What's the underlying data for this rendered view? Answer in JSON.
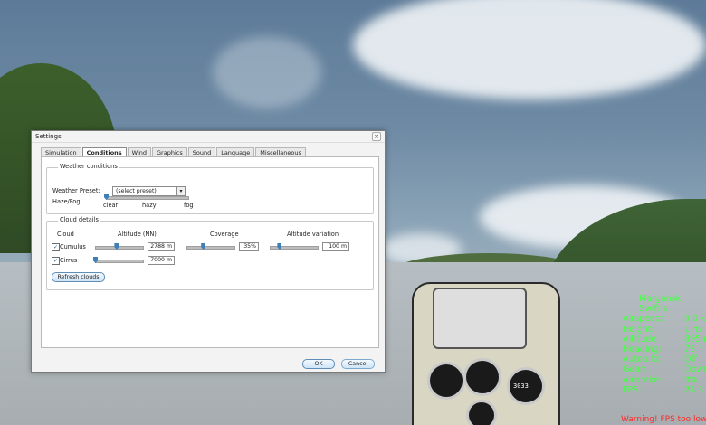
{
  "dialog": {
    "title": "Settings",
    "close_label": "×",
    "tabs": [
      {
        "label": "Simulation",
        "active": false
      },
      {
        "label": "Conditions",
        "active": true
      },
      {
        "label": "Wind",
        "active": false
      },
      {
        "label": "Graphics",
        "active": false
      },
      {
        "label": "Sound",
        "active": false
      },
      {
        "label": "Language",
        "active": false
      },
      {
        "label": "Miscellaneous",
        "active": false
      }
    ],
    "weather": {
      "group_title": "Weather conditions",
      "preset_label": "Weather Preset:",
      "preset_value": "(select preset)",
      "haze_label": "Haze/Fog:",
      "haze_ticks": [
        "clear",
        "hazy",
        "fog"
      ],
      "haze_level": 0.0
    },
    "cloud_details": {
      "group_title": "Cloud details",
      "headers": {
        "cloud": "Cloud",
        "altitude": "Altitude (NN)",
        "coverage": "Coverage",
        "variation": "Altitude variation"
      },
      "rows": [
        {
          "name": "Cumulus",
          "checked": true,
          "altitude": "2788 m",
          "altitude_level": 0.45,
          "coverage": "35%",
          "coverage_level": 0.35,
          "variation": "100 m",
          "variation_level": 0.2
        },
        {
          "name": "Cirrus",
          "checked": true,
          "altitude": "7000 m",
          "altitude_level": 0.0
        }
      ],
      "refresh_label": "Refresh clouds"
    },
    "buttons": {
      "ok": "OK",
      "cancel": "Cancel"
    }
  },
  "hud": {
    "title": "Marganski Swift s",
    "rows": [
      {
        "label": "Airspeed:",
        "value": "0.0 km"
      },
      {
        "label": "Height:",
        "value": "1 m"
      },
      {
        "label": "Altitude:",
        "value": "895 m"
      },
      {
        "label": "Heading:",
        "value": "73 °"
      },
      {
        "label": "Autopilot:",
        "value": "Off"
      },
      {
        "label": "Gear:",
        "value": "Down"
      },
      {
        "label": "Airbrake:",
        "value": "0%"
      },
      {
        "label": "FPS:",
        "value": "24.3"
      }
    ],
    "warning": "Warning! FPS too low"
  },
  "instrument_readout": "3033"
}
